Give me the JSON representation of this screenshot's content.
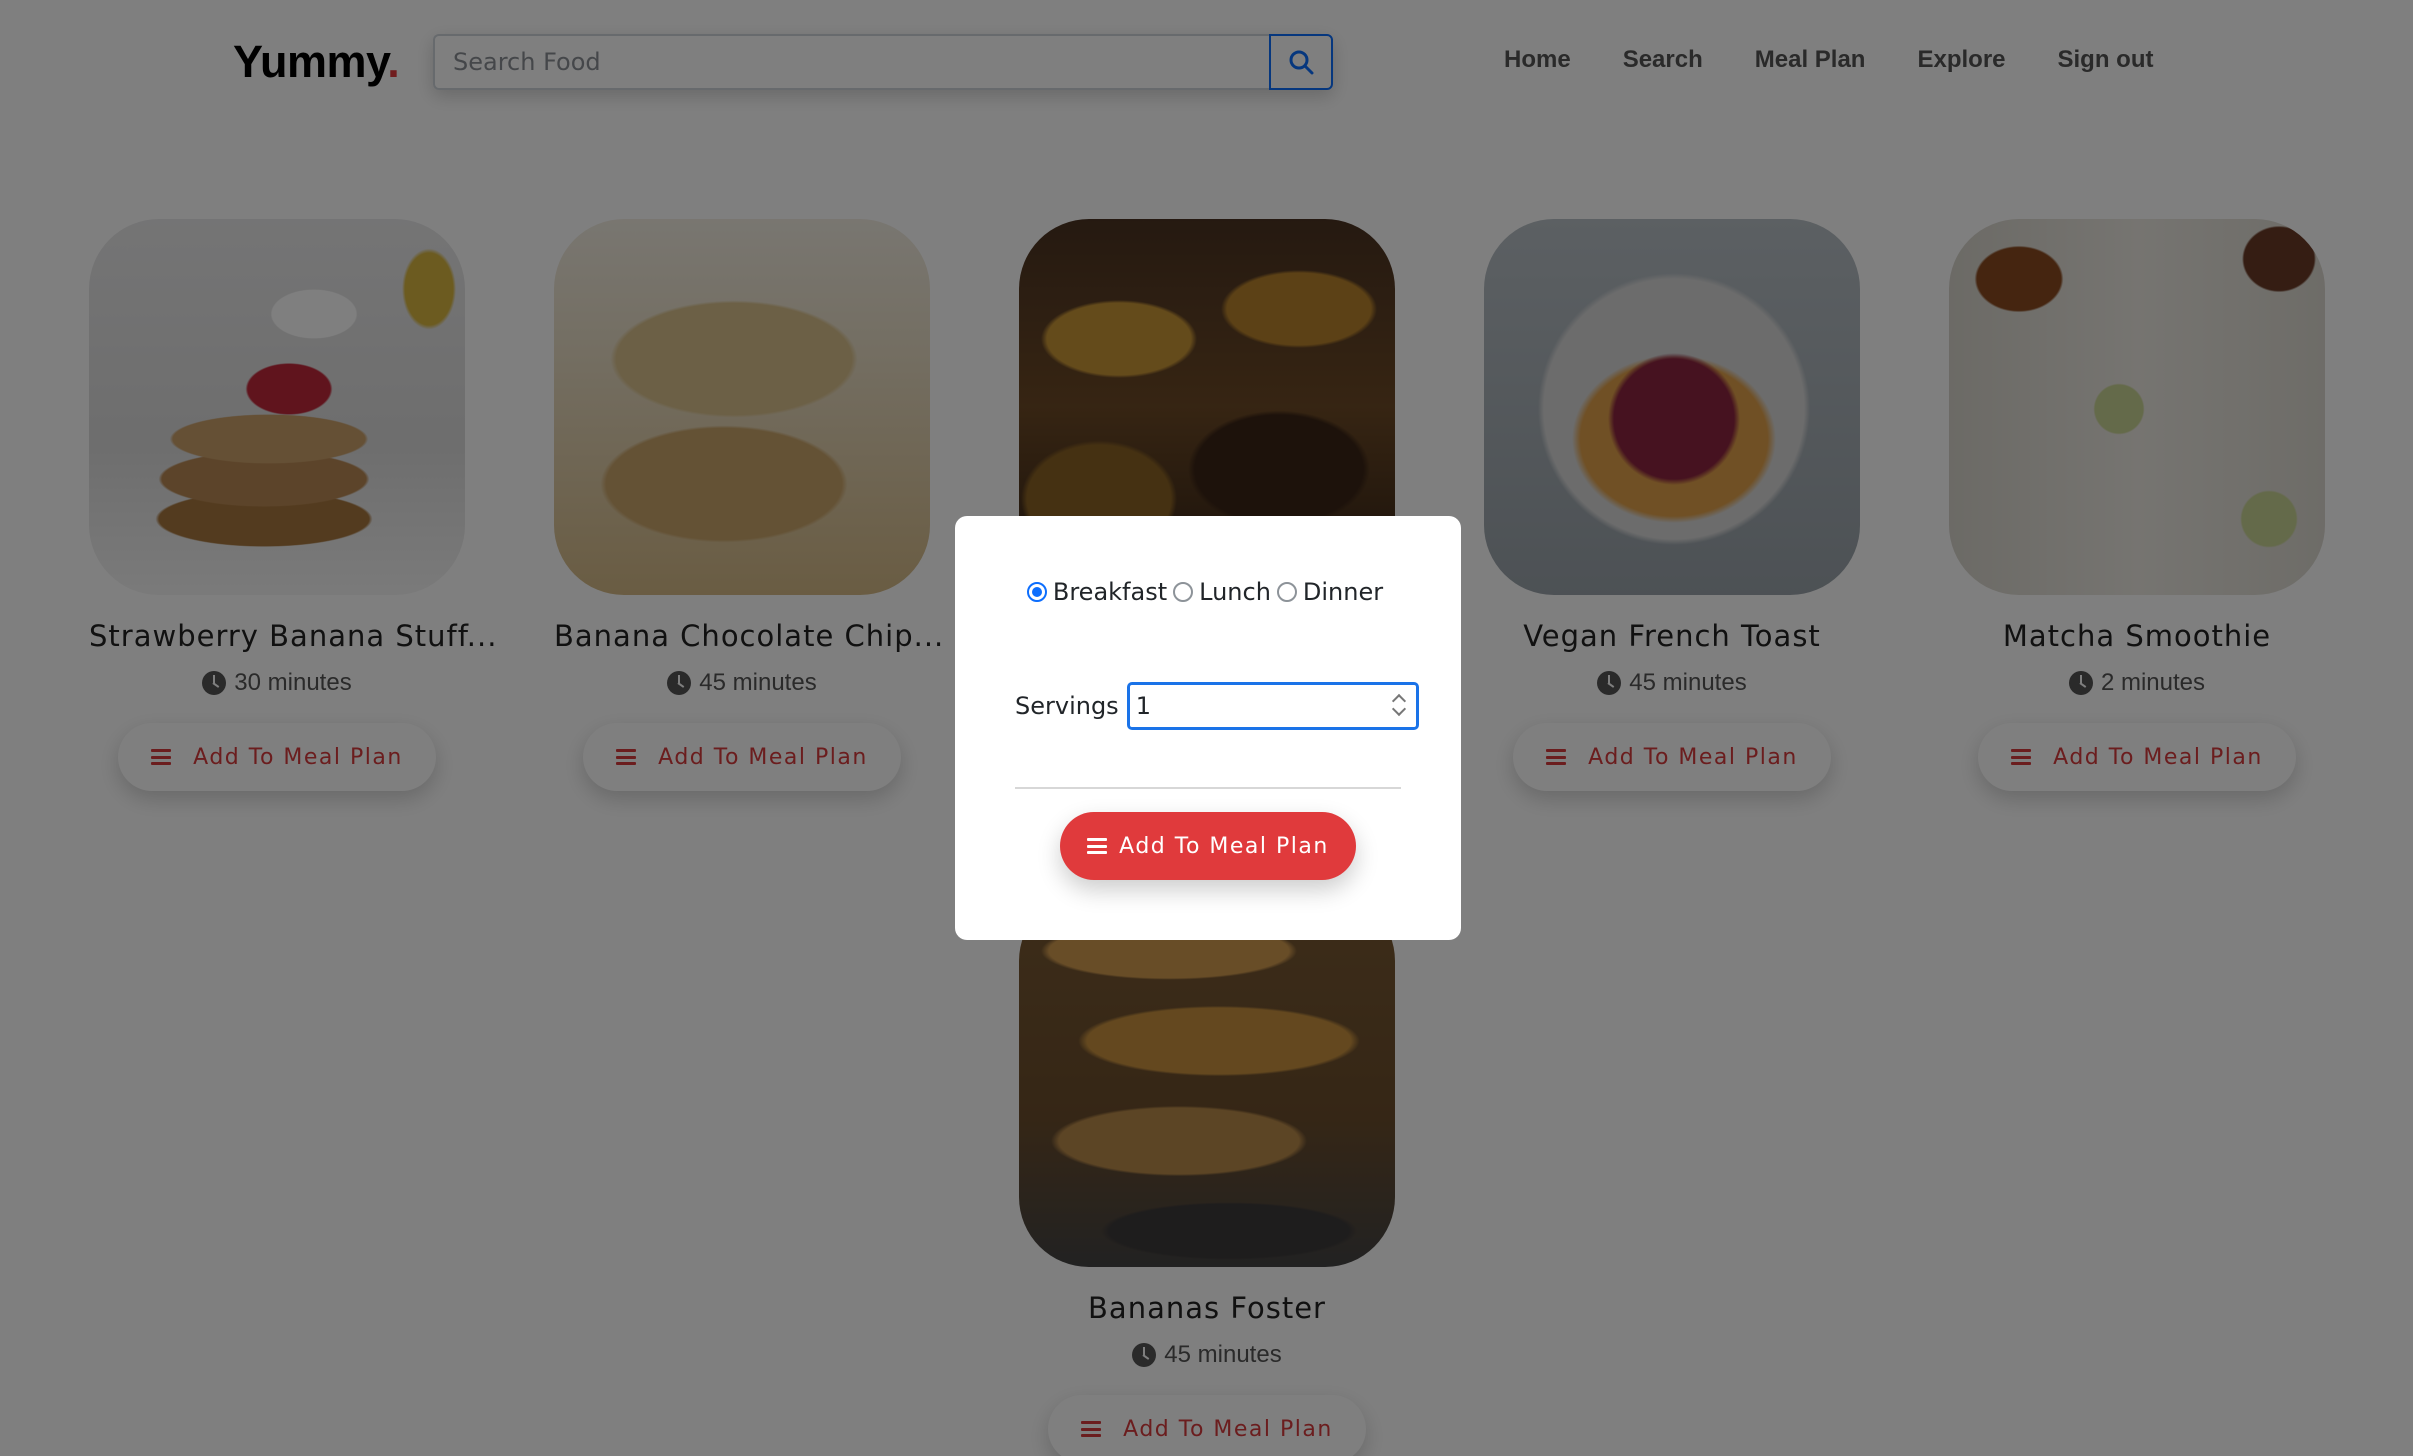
{
  "header": {
    "logo_text": "Yummy",
    "logo_dot": ".",
    "search_placeholder": "Search Food",
    "search_icon": "search-icon",
    "nav": [
      "Home",
      "Search",
      "Meal Plan",
      "Explore",
      "Sign out"
    ]
  },
  "recipes": [
    {
      "title": "Strawberry Banana Stuff...",
      "time": "30 minutes",
      "button": "Add To Meal Plan"
    },
    {
      "title": "Banana Chocolate Chip...",
      "time": "45 minutes",
      "button": "Add To Meal Plan"
    },
    {
      "title": "",
      "time": "",
      "button": ""
    },
    {
      "title": "Vegan French Toast",
      "time": "45 minutes",
      "button": "Add To Meal Plan"
    },
    {
      "title": "Matcha Smoothie",
      "time": "2 minutes",
      "button": "Add To Meal Plan"
    },
    {
      "title": "Bananas Foster",
      "time": "45 minutes",
      "button": "Add To Meal Plan"
    }
  ],
  "modal": {
    "meal_options": [
      "Breakfast",
      "Lunch",
      "Dinner"
    ],
    "selected_meal": "Breakfast",
    "servings_label": "Servings",
    "servings_value": "1",
    "submit_label": "Add To Meal Plan"
  },
  "colors": {
    "accent": "#e03a3c",
    "focus_blue": "#0d6efd"
  }
}
